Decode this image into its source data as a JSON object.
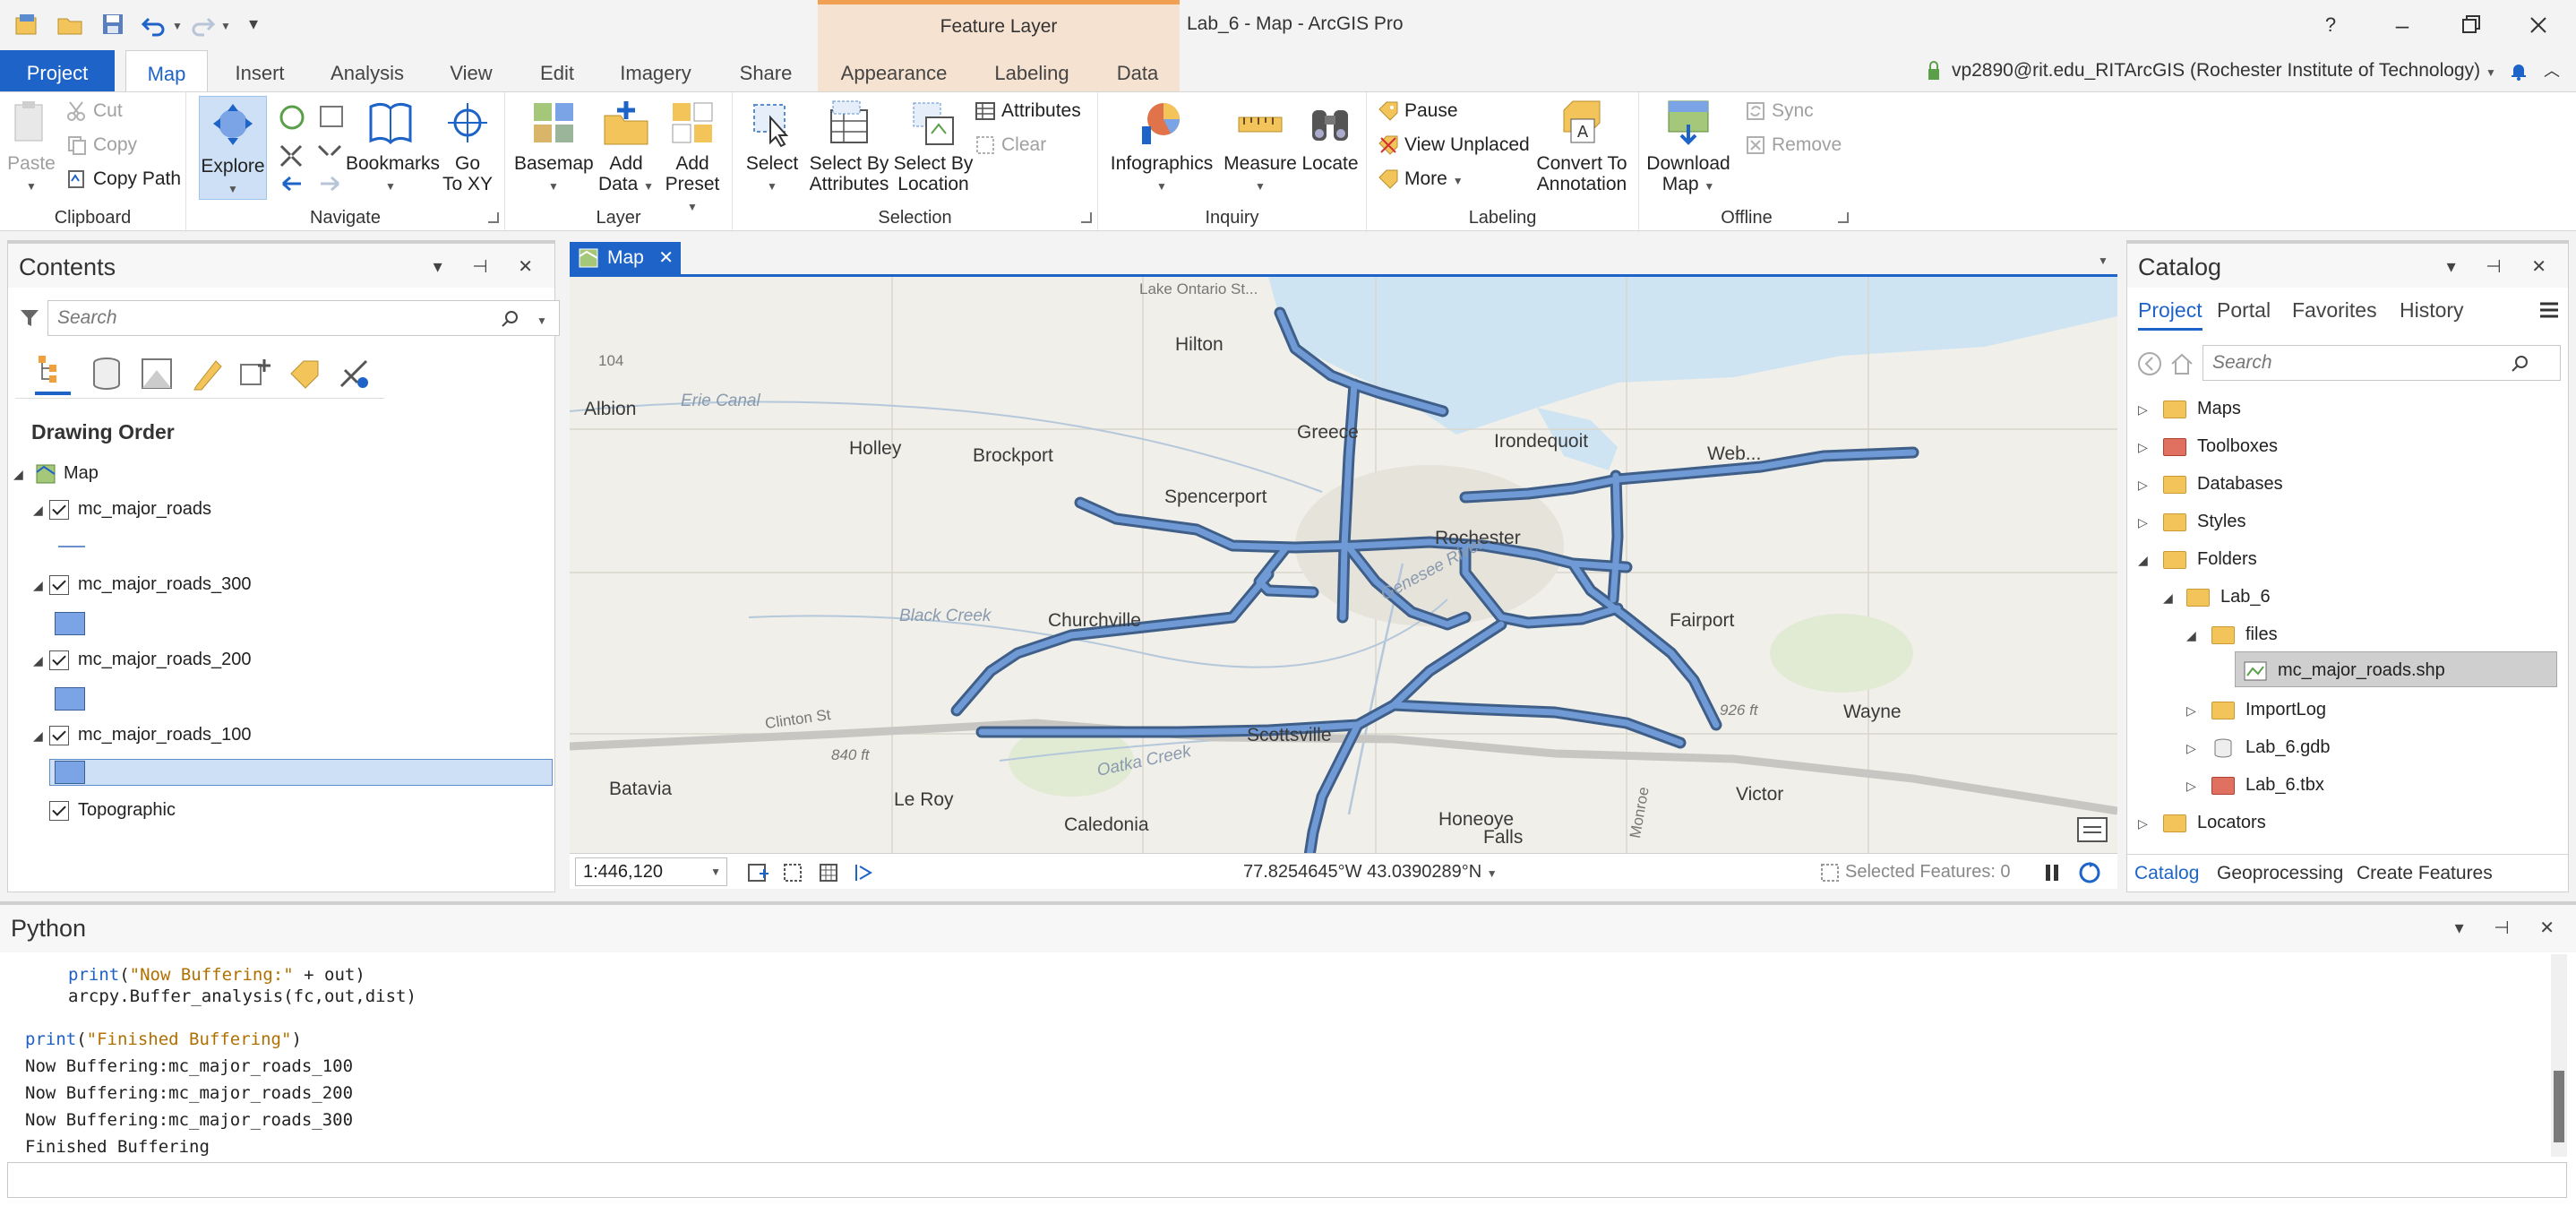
{
  "titlebar": {
    "contextual_tab": "Feature Layer",
    "app_title": "Lab_6 - Map - ArcGIS Pro",
    "help": "?"
  },
  "tabs": {
    "project": "Project",
    "map": "Map",
    "insert": "Insert",
    "analysis": "Analysis",
    "view": "View",
    "edit": "Edit",
    "imagery": "Imagery",
    "share": "Share",
    "appearance": "Appearance",
    "labeling": "Labeling",
    "data": "Data"
  },
  "user": "vp2890@rit.edu_RITArcGIS (Rochester Institute of Technology)",
  "ribbon": {
    "clipboard": {
      "paste": "Paste",
      "cut": "Cut",
      "copy": "Copy",
      "copy_path": "Copy Path",
      "label": "Clipboard"
    },
    "navigate": {
      "explore": "Explore",
      "bookmarks": "Bookmarks",
      "go_to": "Go",
      "go_to_2": "To XY",
      "label": "Navigate"
    },
    "layer": {
      "basemap": "Basemap",
      "add_data": "Add",
      "add_data_2": "Data",
      "add_preset": "Add",
      "add_preset_2": "Preset",
      "label": "Layer"
    },
    "selection": {
      "select": "Select",
      "select_attr": "Select By",
      "select_attr_2": "Attributes",
      "select_loc": "Select By",
      "select_loc_2": "Location",
      "attributes": "Attributes",
      "clear": "Clear",
      "label": "Selection"
    },
    "inquiry": {
      "infographics": "Infographics",
      "measure": "Measure",
      "locate": "Locate",
      "label": "Inquiry"
    },
    "labeling": {
      "pause": "Pause",
      "view_unplaced": "View Unplaced",
      "more": "More",
      "convert": "Convert To",
      "convert_2": "Annotation",
      "label": "Labeling"
    },
    "offline": {
      "download": "Download",
      "download_2": "Map",
      "sync": "Sync",
      "remove": "Remove",
      "label": "Offline"
    }
  },
  "contents": {
    "title": "Contents",
    "search_placeholder": "Search",
    "drawing_order": "Drawing Order",
    "map": "Map",
    "layers": [
      "mc_major_roads",
      "mc_major_roads_300",
      "mc_major_roads_200",
      "mc_major_roads_100",
      "Topographic"
    ]
  },
  "map": {
    "tab": "Map",
    "scale": "1:446,120",
    "coords": "77.8254645°W 43.0390289°N",
    "selected": "Selected Features: 0",
    "labels": {
      "lake": "Lake Ontario St...",
      "hilton": "Hilton",
      "albion": "Albion",
      "erie": "Erie Canal",
      "r104": "104",
      "holley": "Holley",
      "brockport": "Brockport",
      "greece": "Greece",
      "irondequoit": "Irondequoit",
      "webster": "Web...",
      "spencerport": "Spencerport",
      "rochester": "Rochester",
      "genesee": "Genesee River",
      "black_creek": "Black Creek",
      "churchville": "Churchville",
      "fairport": "Fairport",
      "clinton": "Clinton St",
      "ft840": "840 ft",
      "oatka": "Oatka Creek",
      "scottsville": "Scottsville",
      "ft926": "926 ft",
      "wayne": "Wayne",
      "batavia": "Batavia",
      "leroy": "Le Roy",
      "monroe": "Monroe",
      "victor": "Victor",
      "caledonia": "Caledonia",
      "honeoye": "Honeoye",
      "falls": "Falls"
    }
  },
  "catalog": {
    "title": "Catalog",
    "tabs": [
      "Project",
      "Portal",
      "Favorites",
      "History"
    ],
    "search_placeholder": "Search",
    "items": {
      "maps": "Maps",
      "toolboxes": "Toolboxes",
      "databases": "Databases",
      "styles": "Styles",
      "folders": "Folders",
      "lab6": "Lab_6",
      "files": "files",
      "shp": "mc_major_roads.shp",
      "importlog": "ImportLog",
      "gdb": "Lab_6.gdb",
      "tbx": "Lab_6.tbx",
      "locators": "Locators"
    },
    "bottom_tabs": [
      "Catalog",
      "Geoprocessing",
      "Create Features"
    ]
  },
  "python": {
    "title": "Python",
    "line1_fn": "print",
    "line1_str": "\"Now Buffering:\"",
    "line1_rest": " + out)",
    "line2": "arcpy.Buffer_analysis(fc,out,dist)",
    "line3_fn": "print",
    "line3_str": "\"Finished Buffering\"",
    "line3_end": ")",
    "output": [
      "Now Buffering:mc_major_roads_100",
      "Now Buffering:mc_major_roads_200",
      "Now Buffering:mc_major_roads_300",
      "Finished Buffering"
    ]
  },
  "colors": {
    "accent": "#1e64c8",
    "road": "#5a8ccf",
    "water": "#cfe4f2"
  }
}
